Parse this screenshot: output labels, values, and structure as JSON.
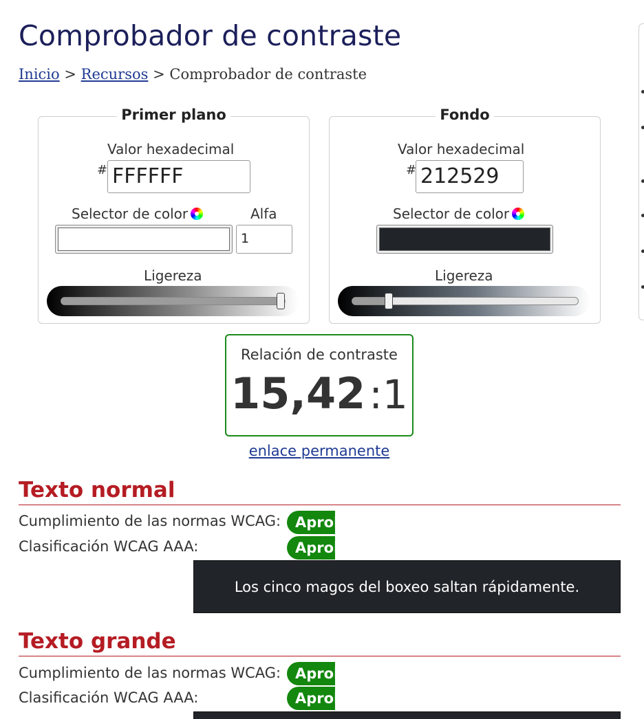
{
  "page": {
    "title": "Comprobador de contraste",
    "breadcrumb": {
      "home": "Inicio",
      "separator": ">",
      "resources": "Recursos",
      "current": "Comprobador de contraste"
    }
  },
  "foreground": {
    "legend": "Primer plano",
    "hex_label": "Valor hexadecimal",
    "hash": "#",
    "hex_value": "FFFFFF",
    "picker_label": "Selector de color",
    "picker_color": "#ffffff",
    "alpha_label": "Alfa",
    "alpha_value": "1",
    "lightness_label": "Ligereza",
    "lightness_level": 1.0
  },
  "background": {
    "legend": "Fondo",
    "hex_label": "Valor hexadecimal",
    "hash": "#",
    "hex_value": "212529",
    "picker_label": "Selector de color",
    "picker_color": "#212529",
    "lightness_label": "Ligereza",
    "lightness_level": 0.15
  },
  "result": {
    "label": "Relación de contraste",
    "ratio": "15,42",
    "suffix": ":1",
    "permalink": "enlace permanente",
    "border_color": "#1a8a1a"
  },
  "normal_text": {
    "title": "Texto normal",
    "wcag_label": "Cumplimiento de las normas WCAG:",
    "wcag_badge": "Aprobado",
    "aaa_label": "Clasificación WCAG AAA:",
    "aaa_badge": "Aprobado",
    "sample": "Los cinco magos del boxeo saltan rápidamente."
  },
  "large_text": {
    "title": "Texto grande",
    "wcag_label": "Cumplimiento de las normas WCAG:",
    "wcag_badge": "Aprobado",
    "aaa_label": "Clasificación WCAG AAA:",
    "aaa_badge": "Aprobado"
  },
  "colors": {
    "heading": "#1b1f5a",
    "section": "#b51c23",
    "pass": "#13870e",
    "link": "#1f3a93"
  }
}
